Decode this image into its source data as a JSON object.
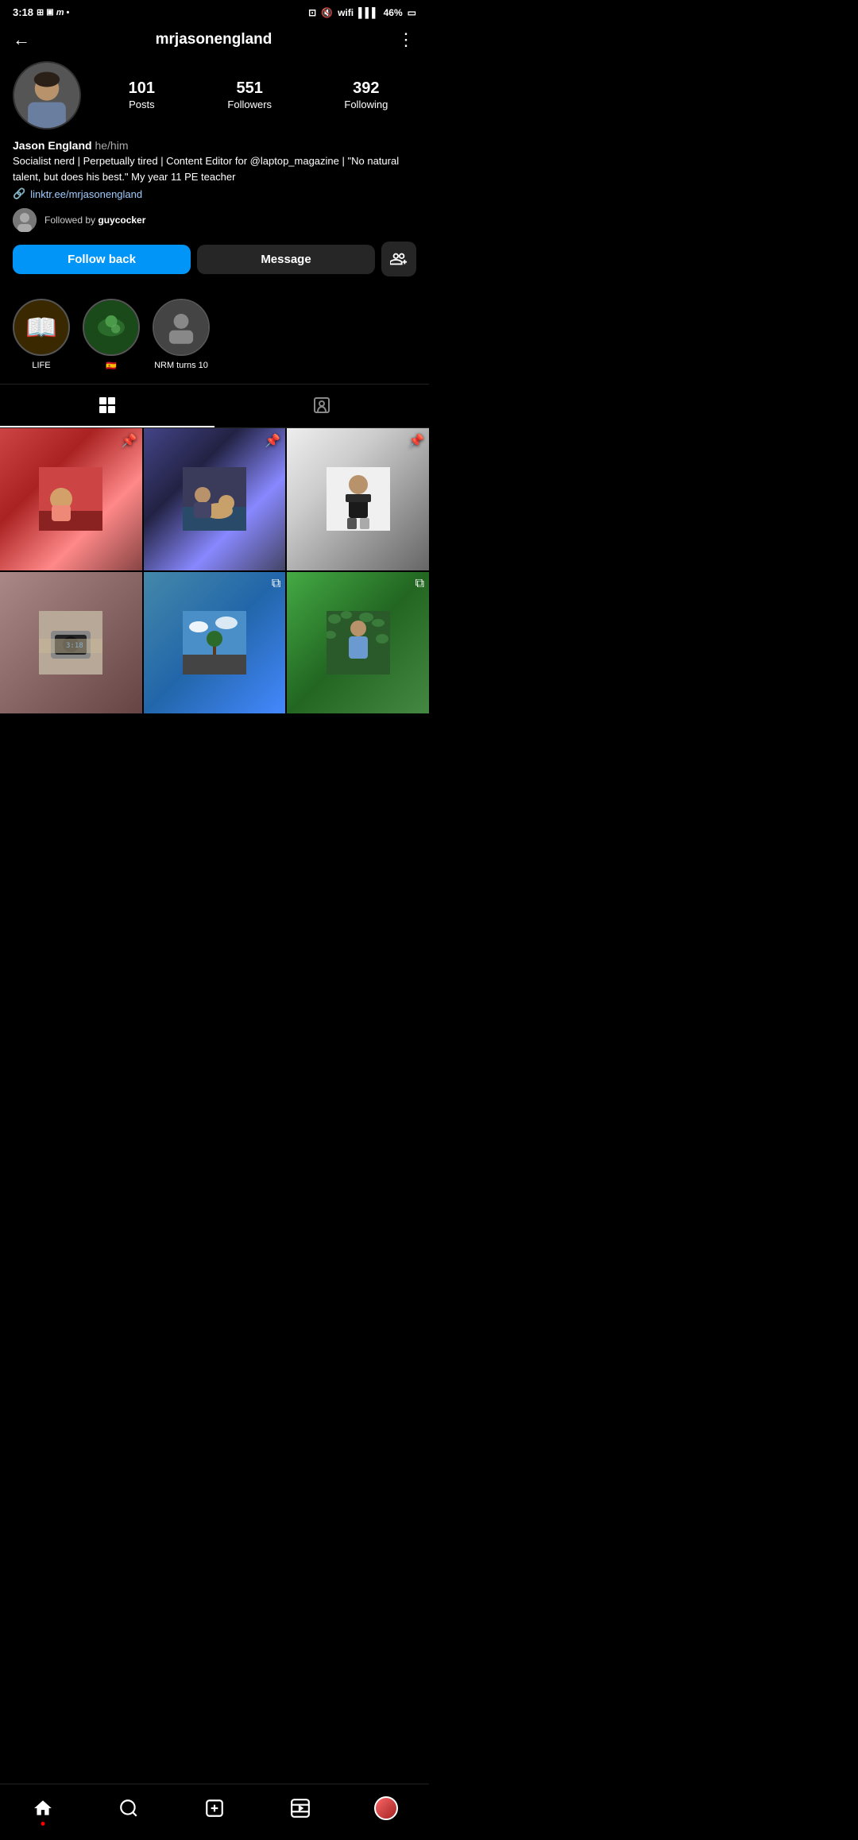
{
  "statusBar": {
    "time": "3:18",
    "battery": "46%"
  },
  "header": {
    "backLabel": "←",
    "username": "mrjasonengland",
    "moreLabel": "⋮"
  },
  "profile": {
    "displayName": "Jason England",
    "pronouns": "he/him",
    "bio": "Socialist nerd | Perpetually tired | Content Editor for @laptop_magazine | \"No natural talent, but does his best.\" My year 11 PE teacher",
    "link": "linktr.ee/mrjasonengland",
    "stats": {
      "posts": {
        "count": "101",
        "label": "Posts"
      },
      "followers": {
        "count": "551",
        "label": "Followers"
      },
      "following": {
        "count": "392",
        "label": "Following"
      }
    },
    "followedBy": "Followed by ",
    "followedByUser": "guycocker"
  },
  "buttons": {
    "followBack": "Follow back",
    "message": "Message"
  },
  "highlights": [
    {
      "label": "LIFE",
      "icon": "📖",
      "type": "book"
    },
    {
      "label": "🇪🇸",
      "icon": "🦎",
      "type": "image"
    },
    {
      "label": "NRM turns 10",
      "icon": "👤",
      "type": "image"
    }
  ],
  "tabs": [
    {
      "id": "grid",
      "active": true
    },
    {
      "id": "tagged",
      "active": false
    }
  ],
  "posts": [
    {
      "id": 1,
      "pinned": true,
      "multi": false,
      "color": "photo-1"
    },
    {
      "id": 2,
      "pinned": true,
      "multi": false,
      "color": "photo-2"
    },
    {
      "id": 3,
      "pinned": true,
      "multi": false,
      "color": "photo-3"
    },
    {
      "id": 4,
      "pinned": false,
      "multi": false,
      "color": "photo-4"
    },
    {
      "id": 5,
      "pinned": false,
      "multi": true,
      "color": "photo-5"
    },
    {
      "id": 6,
      "pinned": false,
      "multi": true,
      "color": "photo-6"
    }
  ],
  "nav": {
    "home": "home",
    "search": "search",
    "create": "create",
    "reels": "reels",
    "profile": "profile"
  }
}
